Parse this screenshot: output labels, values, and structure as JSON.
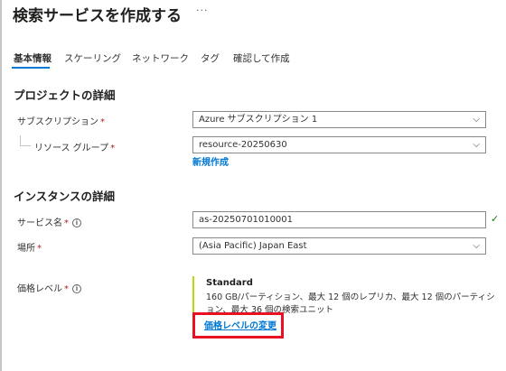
{
  "page": {
    "title": "検索サービスを作成する",
    "more_label": "···"
  },
  "tabs": [
    {
      "label": "基本情報",
      "active": true
    },
    {
      "label": "スケーリング",
      "active": false
    },
    {
      "label": "ネットワーク",
      "active": false
    },
    {
      "label": "タグ",
      "active": false
    },
    {
      "label": "確認して作成",
      "active": false
    }
  ],
  "project": {
    "heading": "プロジェクトの詳細",
    "subscription_label": "サブスクリプション",
    "subscription_value": "Azure サブスクリプション 1",
    "resource_group_label": "リソース グループ",
    "resource_group_value": "resource-20250630",
    "create_new_label": "新規作成"
  },
  "instance": {
    "heading": "インスタンスの詳細",
    "service_name_label": "サービス名",
    "service_name_value": "as-20250701010001",
    "location_label": "場所",
    "location_value": "(Asia Pacific) Japan East",
    "pricing_label": "価格レベル",
    "pricing_tier": "Standard",
    "pricing_desc": "160 GB/パーティション、最大 12 個のレプリカ、最大 12 個のパーティション、最大 36 個の検索ユニット",
    "change_pricing_label": "価格レベルの変更"
  },
  "required_mark": "*",
  "info_glyph": "i",
  "check_glyph": "✓",
  "chevron_glyph": "⌵",
  "colors": {
    "accent": "#0078d4",
    "required": "#a4262c",
    "success": "#107c10",
    "highlight": "#e81123",
    "tier_bar": "#bad80a"
  }
}
